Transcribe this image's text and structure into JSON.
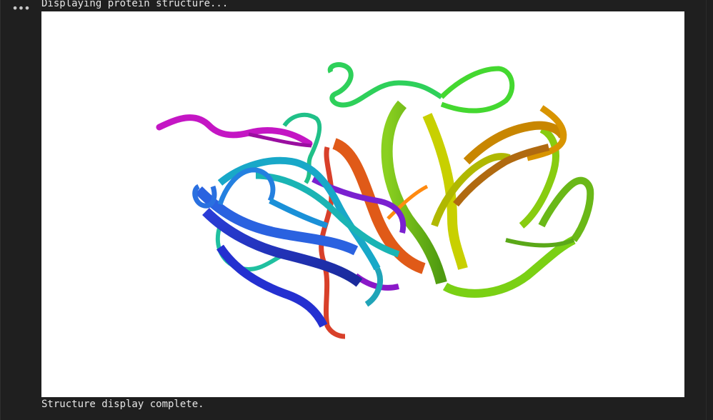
{
  "cell": {
    "more_icon": "ellipsis-icon",
    "more_label": "•••"
  },
  "output": {
    "status_start": "Displaying protein structure...",
    "status_end": "Structure display complete."
  },
  "viewer": {
    "image": "protein-ribbon-structure",
    "background_color": "#ffffff",
    "ribbon_colors": [
      "#2a2ad0",
      "#2060e0",
      "#1aa0d0",
      "#20c0a0",
      "#30d060",
      "#70d020",
      "#b0d000",
      "#c0a000",
      "#c07000",
      "#e06020",
      "#d03a20",
      "#7a10c8",
      "#c010c0"
    ]
  }
}
